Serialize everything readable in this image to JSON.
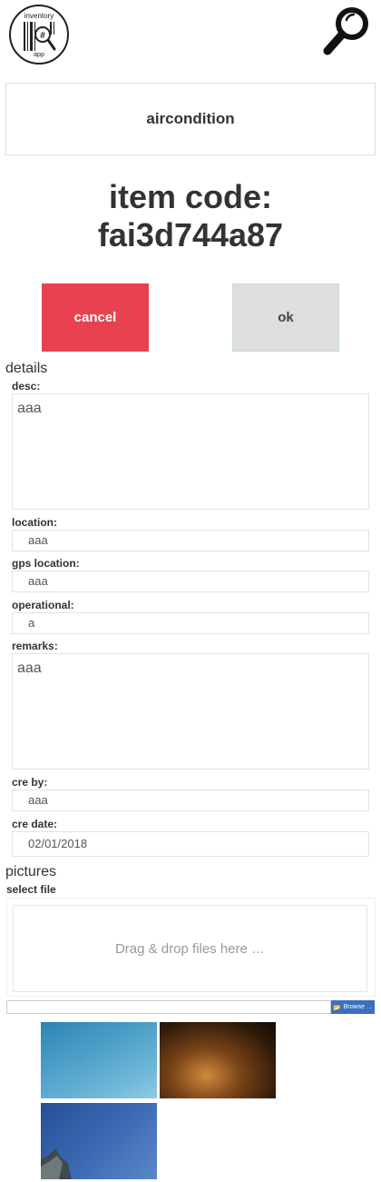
{
  "logo": {
    "top_text": "inventory",
    "bottom_text": "app"
  },
  "header": {
    "item_name": "aircondition"
  },
  "item_code": {
    "label": "item code:",
    "value": "fai3d744a87"
  },
  "buttons": {
    "cancel": "cancel",
    "ok": "ok"
  },
  "details": {
    "title": "details",
    "desc": {
      "label": "desc:",
      "value": "aaa"
    },
    "location": {
      "label": "location:",
      "value": "aaa"
    },
    "gps_location": {
      "label": "gps location:",
      "value": "aaa"
    },
    "operational": {
      "label": "operational:",
      "value": "a"
    },
    "remarks": {
      "label": "remarks:",
      "value": "aaa"
    },
    "cre_by": {
      "label": "cre by:",
      "value": "aaa"
    },
    "cre_date": {
      "label": "cre date:",
      "value": "02/01/2018"
    }
  },
  "pictures": {
    "title": "pictures",
    "select_file_label": "select file",
    "dropzone_text": "Drag & drop files here …",
    "browse_label": "Browse …"
  }
}
